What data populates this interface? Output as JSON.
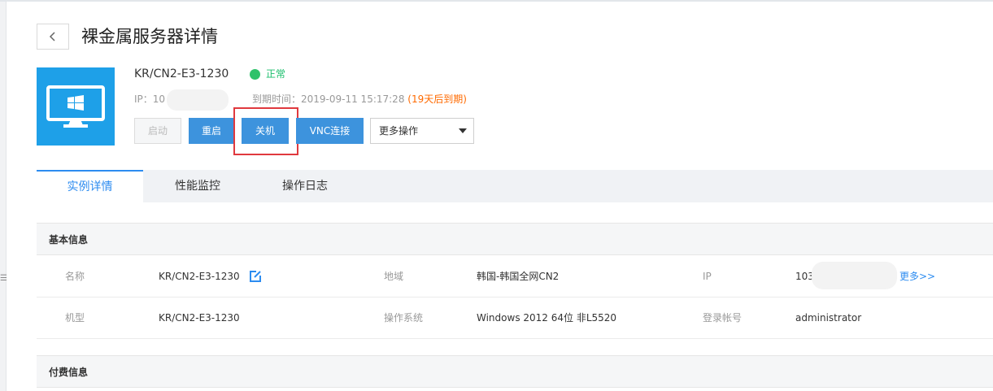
{
  "header": {
    "title": "裸金属服务器详情",
    "back_icon": "chevron-left-icon"
  },
  "server": {
    "name": "KR/CN2-E3-1230",
    "status": "正常",
    "status_color": "#2ec26a",
    "ip_label": "IP：10",
    "expire_label": "到期时间：2019-09-11 15:17:28",
    "expire_note": "(19天后到期)",
    "tile_color": "#1ea0e8",
    "tile_icon": "windows-monitor-icon"
  },
  "actions": {
    "start": "启动",
    "restart": "重启",
    "shutdown": "关机",
    "vnc": "VNC连接",
    "more": "更多操作"
  },
  "tabs": [
    {
      "label": "实例详情",
      "active": true
    },
    {
      "label": "性能监控",
      "active": false
    },
    {
      "label": "操作日志",
      "active": false
    }
  ],
  "basic_info": {
    "title": "基本信息",
    "rows": [
      [
        {
          "label": "名称",
          "value": "KR/CN2-E3-1230"
        },
        {
          "label": "地域",
          "value": "韩国-韩国全网CN2"
        },
        {
          "label": "IP",
          "value": "103"
        }
      ],
      [
        {
          "label": "机型",
          "value": "KR/CN2-E3-1230"
        },
        {
          "label": "操作系统",
          "value": "Windows 2012 64位 非L5520"
        },
        {
          "label": "登录帐号",
          "value": "administrator"
        }
      ]
    ],
    "more_link": "更多>>"
  },
  "billing_info": {
    "title": "付费信息"
  },
  "colors": {
    "primary": "#3d93dd",
    "tab_active": "#2d8cf0",
    "warning": "#ff6a00",
    "highlight": "#e0393e"
  }
}
